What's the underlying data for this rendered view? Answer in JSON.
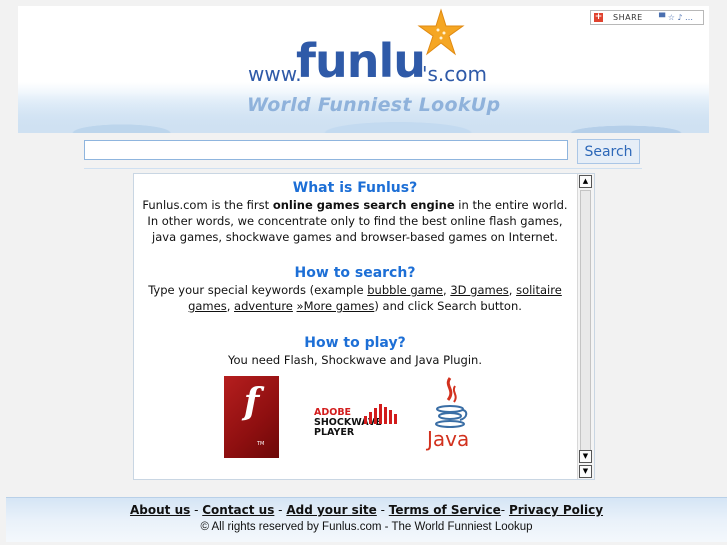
{
  "header": {
    "share_label": "SHARE",
    "share_icons": "▀ ☆ ♪ …",
    "logo_www": "www.",
    "logo_main": "funlu",
    "logo_com": "'s.com",
    "tagline": "World Funniest LookUp",
    "starfish_color": "#f5a623"
  },
  "search": {
    "input_value": "",
    "placeholder": "",
    "button_label": "Search"
  },
  "content": {
    "what_title": "What is Funlus?",
    "what_text_1": "Funlus.com is the first ",
    "what_text_bold": "online games search engine",
    "what_text_2": " in the entire world. In other words, we concentrate only to find the best online flash games, java games, shockwave games and browser-based games on Internet.",
    "how_search_title": "How to search?",
    "how_search_prefix": "Type your special keywords (example ",
    "kw_bubble": "bubble game",
    "comma1": ", ",
    "kw_3d": "3D games",
    "comma2": ", ",
    "kw_solitaire": "solitaire games",
    "comma3": ", ",
    "kw_adventure": "adventure",
    "space": " ",
    "kw_more": "»More games",
    "how_search_suffix": ") and click Search button.",
    "how_play_title": "How to play?",
    "how_play_text": "You need Flash, Shockwave and Java Plugin.",
    "flash_letter": "f",
    "flash_tm": "TM",
    "sw_adobe": "ADOBE",
    "sw_shockwave": "SHOCKWAVE",
    "sw_player": "PLAYER",
    "java_text": "Java",
    "scroll_up": "▲",
    "scroll_down": "▼"
  },
  "footer": {
    "links": [
      "About us",
      "Contact us",
      "Add your site",
      "Terms of Service",
      "Privacy Policy"
    ],
    "sep1": " - ",
    "sep2": " - ",
    "sep3": " - ",
    "sep4": "- ",
    "copyright": "© All rights reserved by Funlus.com - The World Funniest Lookup"
  },
  "colors": {
    "accent": "#1d6fd6",
    "logo": "#2f5aa8",
    "tagline": "#8fb2db",
    "flash_red": "#b51e1e",
    "java_red": "#d2311e"
  }
}
